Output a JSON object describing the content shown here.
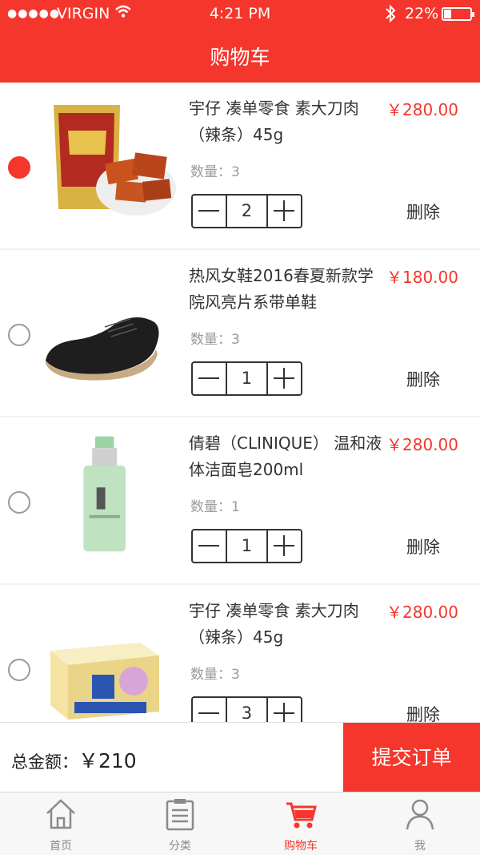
{
  "status_bar": {
    "signal": "●●●●●",
    "carrier": "VIRGIN",
    "time": "4:21 PM",
    "battery": "22%"
  },
  "header": {
    "title": "购物车"
  },
  "cart_items": [
    {
      "name": "宇仔 凑单零食 素大刀肉（辣条）45g",
      "price": "￥280.00",
      "quantity_label": "数量：3",
      "count": "2",
      "delete_label": "删除",
      "selected": true,
      "image": "snack-bag-image"
    },
    {
      "name": "热风女鞋2016春夏新款学院风亮片系带单鞋",
      "price": "￥180.00",
      "quantity_label": "数量：3",
      "count": "1",
      "delete_label": "删除",
      "selected": false,
      "image": "shoe-image"
    },
    {
      "name": "倩碧（CLINIQUE） 温和液体洁面皂200ml",
      "price": "￥280.00",
      "quantity_label": "数量：1",
      "count": "1",
      "delete_label": "删除",
      "selected": false,
      "image": "cleanser-bottle-image"
    },
    {
      "name": "宇仔 凑单零食 素大刀肉（辣条）45g",
      "price": "￥280.00",
      "quantity_label": "数量：3",
      "count": "3",
      "delete_label": "删除",
      "selected": false,
      "image": "tissue-box-image"
    }
  ],
  "footer": {
    "total_label": "总金额：",
    "total_amount": "￥210",
    "submit_label": "提交订单"
  },
  "tabbar": {
    "tabs": [
      {
        "label": "首页",
        "icon": "home-icon"
      },
      {
        "label": "分类",
        "icon": "category-icon"
      },
      {
        "label": "购物车",
        "icon": "cart-icon"
      },
      {
        "label": "我",
        "icon": "user-icon"
      }
    ],
    "active_index": 2
  },
  "colors": {
    "accent": "#f5362c",
    "muted": "#9a9a9a",
    "text": "#333333"
  }
}
